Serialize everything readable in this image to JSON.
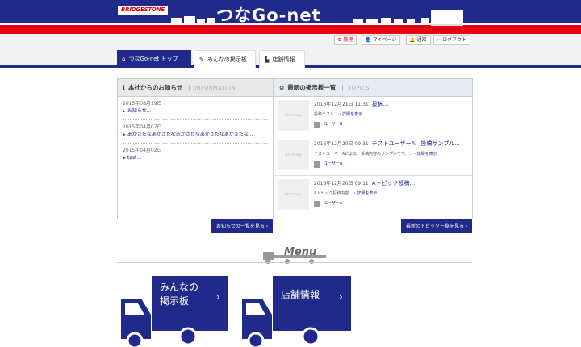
{
  "header": {
    "brand_logo": "BRIDGESTONE",
    "site_title": "つなGo-net"
  },
  "utility_links": [
    {
      "label": "管理",
      "icon": "gear-icon"
    },
    {
      "label": "マイページ",
      "icon": "person-icon"
    },
    {
      "label": "通知",
      "icon": "bell-icon"
    },
    {
      "label": "ログアウト",
      "icon": "logout-icon"
    }
  ],
  "nav_tabs": [
    {
      "label": "つなGo-net トップ",
      "icon": "home-icon",
      "active": true
    },
    {
      "label": "みんなの掲示板",
      "icon": "pencil-icon",
      "active": false
    },
    {
      "label": "店舗情報",
      "icon": "store-icon",
      "active": false
    }
  ],
  "news_panel": {
    "title": "本社からのお知らせ",
    "subtitle": "INFORMATION",
    "items": [
      {
        "date": "2015年08月19日",
        "text": "お知らせ..."
      },
      {
        "date": "2015年04月07日",
        "text": "あかさたなあかさたなあかさたなあかさたなあかさたな..."
      },
      {
        "date": "2015年04月02日",
        "text": "test..."
      }
    ],
    "more_button": "お知らせの一覧を見る"
  },
  "topics_panel": {
    "title": "最新の掲示板一覧",
    "subtitle": "TOPICS",
    "no_image": "No image",
    "detail_link": "詳細を表示",
    "items": [
      {
        "datetime": "2016年12月21日 11:31",
        "title": "投稿...",
        "excerpt": "投稿テスト...",
        "user": "ユーザーB"
      },
      {
        "datetime": "2016年12月20日 09:31",
        "title": "テストユーザーA　投稿サンプル...",
        "excerpt": "テストユーザーAによる、投稿内容のサンプルです。...",
        "user": "ユーザーA"
      },
      {
        "datetime": "2016年12月20日 09:11",
        "title": "Aトピック投稿...",
        "excerpt": "Aトピック投稿内容...",
        "user": "ユーザーA"
      }
    ],
    "more_button": "最新のトピック一覧を見る"
  },
  "menu": {
    "title": "Menu",
    "items": [
      {
        "line1": "みんなの",
        "line2": "掲示板"
      },
      {
        "line1": "店舗情報",
        "line2": ""
      }
    ]
  },
  "colors": {
    "brand_blue": "#1f2a8a",
    "brand_red": "#e60012"
  }
}
